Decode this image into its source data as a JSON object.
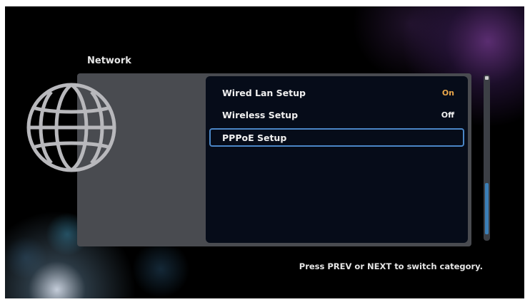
{
  "header": {
    "title": "Network"
  },
  "menu": {
    "items": [
      {
        "label": "Wired Lan Setup",
        "value": "On"
      },
      {
        "label": "Wireless Setup",
        "value": "Off"
      },
      {
        "label": "PPPoE Setup",
        "value": ""
      }
    ],
    "selected_index": 2
  },
  "footer": {
    "hint": "Press PREV or NEXT to switch category."
  },
  "colors": {
    "value_on": "#e8a64a",
    "value_off": "#f0f0f0",
    "selection_border": "#4b86c6",
    "scroll_thumb": "#3b7fb7"
  },
  "icons": {
    "category_icon": "globe-icon"
  }
}
